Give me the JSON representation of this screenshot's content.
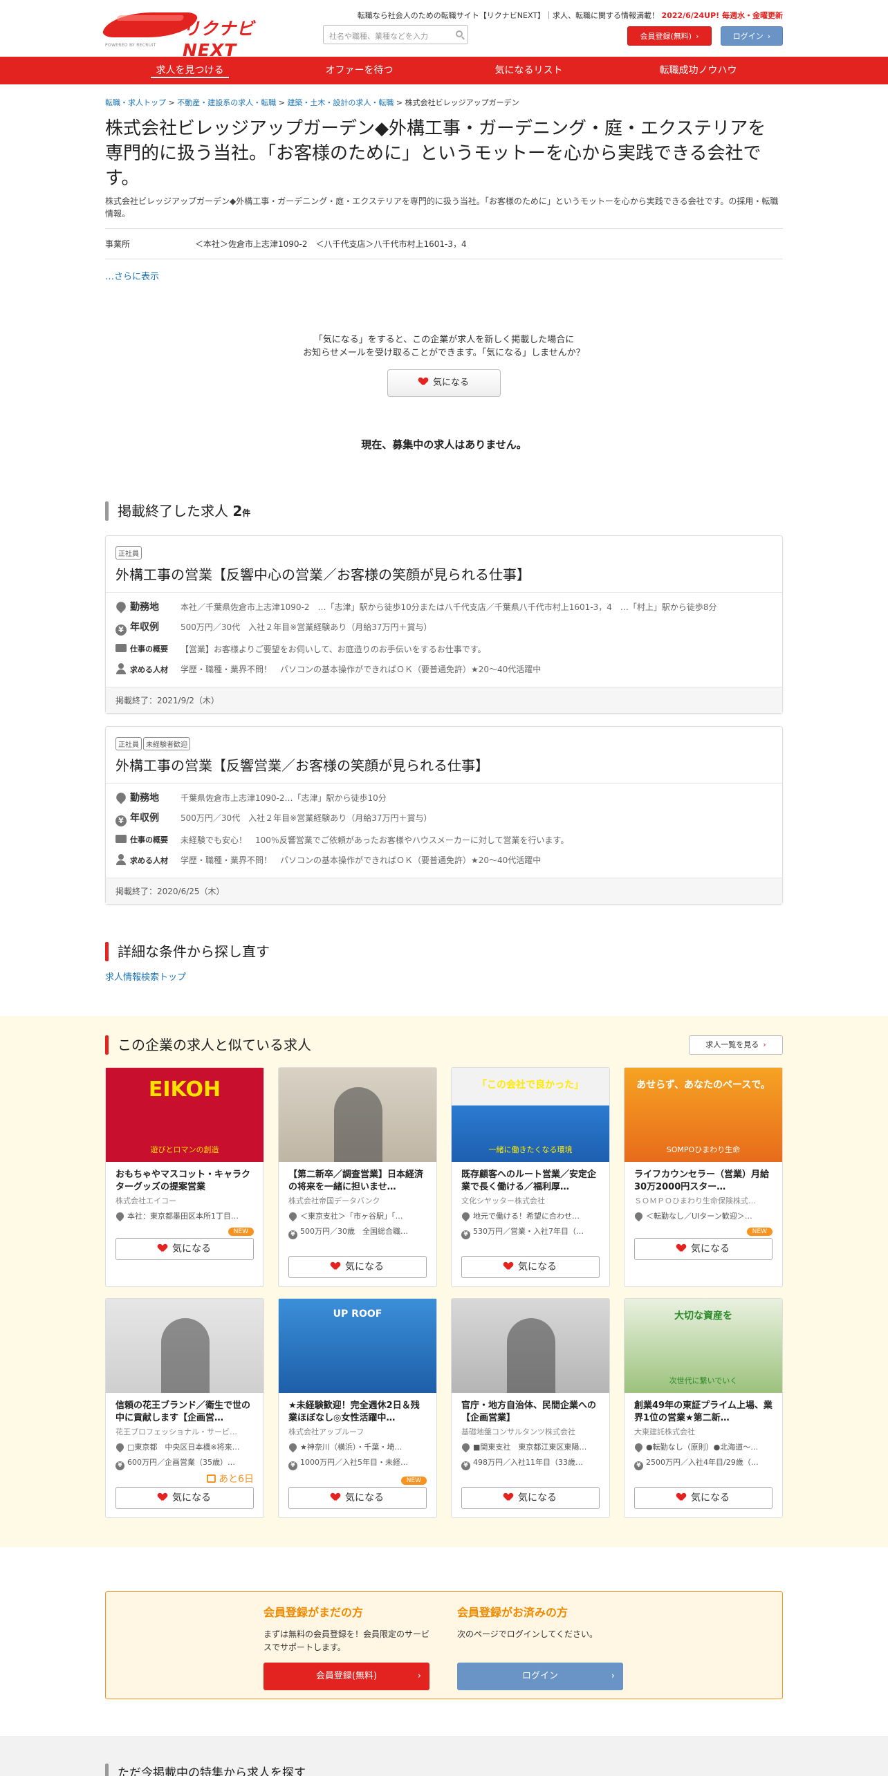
{
  "header": {
    "logo_text": "リクナビNEXT",
    "logo_sub": "POWERED BY RECRUIT",
    "tagline": "転職なら社会人のための転職サイト【リクナビNEXT】｜求人、転職に関する情報満載！",
    "update_note": "2022/6/24UP! 毎週水・金曜更新",
    "search_placeholder": "社名や職種、業種などを入力",
    "register_button": "会員登録(無料)",
    "login_button": "ログイン"
  },
  "nav": {
    "items": [
      {
        "label": "求人を見つける"
      },
      {
        "label": "オファーを待つ"
      },
      {
        "label": "気になるリスト"
      },
      {
        "label": "転職成功ノウハウ"
      }
    ]
  },
  "breadcrumb": {
    "items": [
      "転職・求人トップ",
      "不動産・建設系の求人・転職",
      "建築・土木・設計の求人・転職",
      "株式会社ビレッジアップガーデン"
    ]
  },
  "company": {
    "title": "株式会社ビレッジアップガーデン◆外構工事・ガーデニング・庭・エクステリアを専門的に扱う当社。「お客様のために」というモットーを心から実践できる会社です。",
    "description": "株式会社ビレッジアップガーデン◆外構工事・ガーデニング・庭・エクステリアを専門的に扱う当社。「お客様のために」というモットーを心から実践できる会社です。の採用・転職情報。",
    "office_label": "事業所",
    "office_value": "＜本社＞佐倉市上志津1090-2　＜八千代支店＞八千代市村上1601-3，4",
    "more_link": "…さらに表示"
  },
  "favorite": {
    "line1": "「気になる」をすると、この企業が求人を新しく掲載した場合に",
    "line2": "お知らせメールを受け取ることができます。「気になる」しませんか？",
    "button": "気になる"
  },
  "no_jobs": "現在、募集中の求人はありません。",
  "ended": {
    "title": "掲載終了した求人",
    "count": "2",
    "unit": "件",
    "jobs": [
      {
        "tags": [
          "正社員"
        ],
        "title": "外構工事の営業【反響中心の営業／お客様の笑顔が見られる仕事】",
        "location_label": "勤務地",
        "location": "本社／千葉県佐倉市上志津1090-2　…「志津」駅から徒歩10分または八千代支店／千葉県八千代市村上1601-3，4　…「村上」駅から徒歩8分",
        "salary_label": "年収例",
        "salary": "500万円／30代　入社２年目※営業経験あり（月給37万円＋賞与）",
        "summary_label": "仕事の概要",
        "summary": "【営業】お客様よりご要望をお伺いして、お庭造りのお手伝いをするお仕事です。",
        "req_label": "求める人材",
        "req": "学歴・職種・業界不問！　パソコンの基本操作ができればＯＫ（要普通免許）★20～40代活躍中",
        "ended": "掲載終了：2021/9/2（木）"
      },
      {
        "tags": [
          "正社員",
          "未経験者歓迎"
        ],
        "title": "外構工事の営業【反響営業／お客様の笑顔が見られる仕事】",
        "location_label": "勤務地",
        "location": "千葉県佐倉市上志津1090-2…「志津」駅から徒歩10分",
        "salary_label": "年収例",
        "salary": "500万円／30代　入社２年目※営業経験あり（月給37万円＋賞与）",
        "summary_label": "仕事の概要",
        "summary": "未経験でも安心！　100％反響営業でご依頼があったお客様やハウスメーカーに対して営業を行います。",
        "req_label": "求める人材",
        "req": "学歴・職種・業界不問！　パソコンの基本操作ができればＯＫ（要普通免許）★20～40代活躍中",
        "ended": "掲載終了：2020/6/25（木）"
      }
    ]
  },
  "search_again": {
    "title": "詳細な条件から探し直す",
    "link": "求人情報検索トップ"
  },
  "similar": {
    "title": "この企業の求人と似ている求人",
    "list_button": "求人一覧を見る",
    "fav_label": "気になる",
    "new_label": "NEW",
    "cards": [
      {
        "thumb_text": "EIKOH",
        "thumb_caption": "遊びとロマンの創造",
        "title": "おもちゃやマスコット・キャラクターグッズの提案営業",
        "company": "株式会社エイコー",
        "location": "本社：東京都墨田区本所1丁目…",
        "salary": "",
        "is_new": true,
        "deadline": ""
      },
      {
        "thumb_text": "",
        "thumb_caption": "",
        "title": "【第二新卒／調査営業】日本経済の将来を一緒に担いませ…",
        "company": "株式会社帝国データバンク",
        "location": "＜東京支社＞「市ヶ谷駅」「…",
        "salary": "500万円／30歳　全国総合職…",
        "is_new": false,
        "deadline": ""
      },
      {
        "thumb_text": "「この会社で良かった」",
        "thumb_caption": "一緒に働きたくなる環境",
        "title": "既存顧客へのルート営業／安定企業で長く働ける／福利厚…",
        "company": "文化シヤッター株式会社",
        "location": "地元で働ける！希望に合わせ…",
        "salary": "530万円／営業・入社7年目（…",
        "is_new": false,
        "deadline": ""
      },
      {
        "thumb_text": "あせらず、あなたのペースで。",
        "thumb_caption": "SOMPOひまわり生命",
        "title": "ライフカウンセラー（営業）月給30万2000円スター…",
        "company": "ＳＯＭＰＯひまわり生命保険株式…",
        "location": "＜転勤なし／UIターン歓迎＞…",
        "salary": "",
        "is_new": true,
        "deadline": ""
      },
      {
        "thumb_text": "",
        "thumb_caption": "",
        "title": "信頼の花王ブランド／衛生で世の中に貢献します【企画営…",
        "company": "花王プロフェッショナル・サービ…",
        "location": "□東京都　中央区日本橋※将来…",
        "salary": "600万円／企画営業（35歳）…",
        "is_new": false,
        "deadline": "あと6日"
      },
      {
        "thumb_text": "UP ROOF",
        "thumb_caption": "",
        "title": "★未経験歓迎！完全週休2日＆残業ほぼなし◎女性活躍中…",
        "company": "株式会社アップルーフ",
        "location": "★神奈川（横浜）・千葉・埼…",
        "salary": "1000万円／入社5年目・未経…",
        "is_new": true,
        "deadline": ""
      },
      {
        "thumb_text": "",
        "thumb_caption": "",
        "title": "官庁・地方自治体、民間企業への【企画営業】",
        "company": "基礎地盤コンサルタンツ株式会社",
        "location": "■関東支社　東京都江東区東陽…",
        "salary": "498万円／入社11年目（33歳…",
        "is_new": false,
        "deadline": ""
      },
      {
        "thumb_text": "大切な資産を",
        "thumb_caption": "次世代に繋いでいく",
        "title": "創業49年の東証プライム上場、業界1位の営業★第二新…",
        "company": "大東建託株式会社",
        "location": "●転勤なし（原則）●北海道～…",
        "salary": "2500万円／入社4年目/29歳（…",
        "is_new": false,
        "deadline": ""
      }
    ]
  },
  "member": {
    "left_title": "会員登録がまだの方",
    "left_text": "まずは無料の会員登録を！会員限定のサービスでサポートします。",
    "left_button": "会員登録(無料)",
    "right_title": "会員登録がお済みの方",
    "right_text": "次のページでログインしてください。",
    "right_button": "ログイン"
  },
  "featured": {
    "title": "ただ今掲載中の特集から求人を探す"
  },
  "colors": {
    "brand_red": "#e32320",
    "login_blue": "#6a93c6",
    "accent_orange": "#f7931e",
    "similar_bg": "#fefae6"
  }
}
